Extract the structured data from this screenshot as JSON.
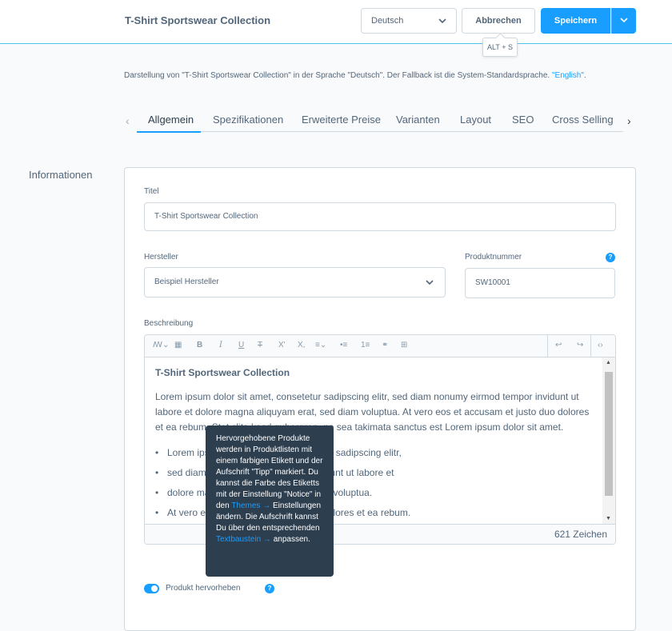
{
  "header": {
    "title": "T-Shirt Sportswear Collection",
    "language": "Deutsch",
    "cancel_label": "Abbrechen",
    "save_label": "Speichern",
    "save_shortcut": "ALT + S"
  },
  "language_info": {
    "text": "Darstellung von \"T-Shirt Sportswear Collection\" in der Sprache \"Deutsch\". Der Fallback ist die System-Standardsprache.",
    "fallback_link": "\"English\"",
    "suffix": "."
  },
  "tabs": [
    {
      "label": "Allgemein",
      "active": true
    },
    {
      "label": "Spezifikationen"
    },
    {
      "label": "Erweiterte Preise"
    },
    {
      "label": "Varianten"
    },
    {
      "label": "Layout"
    },
    {
      "label": "SEO"
    },
    {
      "label": "Cross Selling"
    }
  ],
  "section": {
    "title": "Informationen"
  },
  "form": {
    "title_label": "Titel",
    "title_value": "T-Shirt Sportswear Collection",
    "manufacturer_label": "Hersteller",
    "manufacturer_value": "Beispiel Hersteller",
    "product_number_label": "Produktnummer",
    "product_number_value": "SW10001",
    "description_label": "Beschreibung"
  },
  "editor": {
    "heading": "T-Shirt Sportswear Collection",
    "paragraph_lines": [
      "Lorem ipsum dolor sit amet, consetetur sadipscing elitr, sed diam nonumy eirmod tempor invidunt ut",
      "labore et dolore magna aliquyam erat, sed diam voluptua. At vero eos et accusam et justo duo dolores",
      "et ea rebum. Stet clita kasd gubergren, no sea takimata sanctus est Lorem ipsum dolor sit amet."
    ],
    "list_items": [
      "Lorem ipsum dolor sit amet, consetetur sadipscing elitr,",
      "sed diam nonumy eirmod tempor invidunt ut labore et",
      "dolore magna aliquyam erat, sed diam voluptua.",
      "At vero eos et accusam et justo duo dolores et ea rebum."
    ],
    "char_count": "621 Zeichen"
  },
  "tooltip": {
    "text_1": "Hervorgehobene Produkte werden in Produktlisten mit einem farbigen Etikett und der Aufschrift \"Tipp\" markiert. Du kannst die Farbe des Etiketts mit der Einstellung \"Notice\" in den",
    "link_1": "Themes →",
    "text_2": "Einstellungen ändern. Die Aufschrift kannst Du über den entsprechenden",
    "link_2": "Textbaustein →",
    "text_3": "anpassen."
  },
  "highlight": {
    "label": "Produkt hervorheben",
    "enabled": true
  },
  "colors": {
    "primary": "#189eff",
    "text": "#52667a",
    "dark": "#2d3e4f",
    "border": "#d1d9e0"
  }
}
